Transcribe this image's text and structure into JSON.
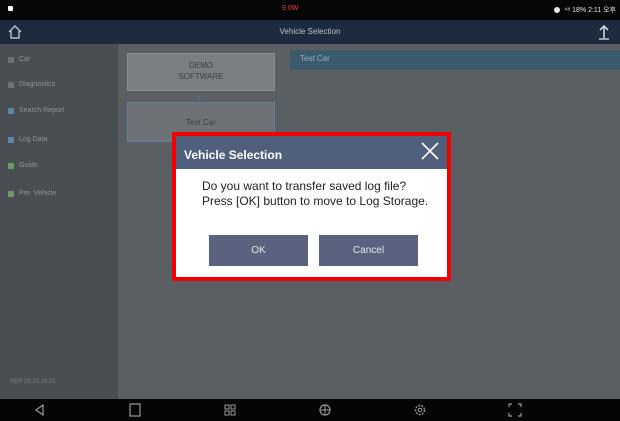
{
  "status_bar": {
    "center_text": "9.0W",
    "right_text": "⁴⁸ 18% 2:11 오후"
  },
  "title_bar": {
    "title": "Vehicle Selection"
  },
  "sidebar": {
    "items": [
      {
        "label": "Car",
        "icon": "car-icon"
      },
      {
        "label": "Diagnostics",
        "icon": "diagnostics-icon"
      },
      {
        "label": "Search Report",
        "icon": "report-icon"
      },
      {
        "label": "Log Data",
        "icon": "log-icon"
      },
      {
        "label": "Guide",
        "icon": "guide-icon"
      },
      {
        "label": "Pre. Vehicle",
        "icon": "vehicle-icon"
      }
    ],
    "version": "VER 19.12.18.01"
  },
  "content": {
    "demo_card": {
      "line1": "DEMO",
      "line2": "SOFTWARE"
    },
    "test_car_card": "Test Car",
    "right_header": "Test Car"
  },
  "dialog": {
    "title": "Vehicle Selection",
    "message_line1": "Do you want to transfer saved log file?",
    "message_line2": "Press [OK] button to move to Log Storage.",
    "ok_label": "OK",
    "cancel_label": "Cancel"
  },
  "colors": {
    "highlight": "#f00000",
    "dialog_header": "#4f5f7c",
    "button": "#5a6280",
    "titlebar": "#1c2b3e"
  }
}
